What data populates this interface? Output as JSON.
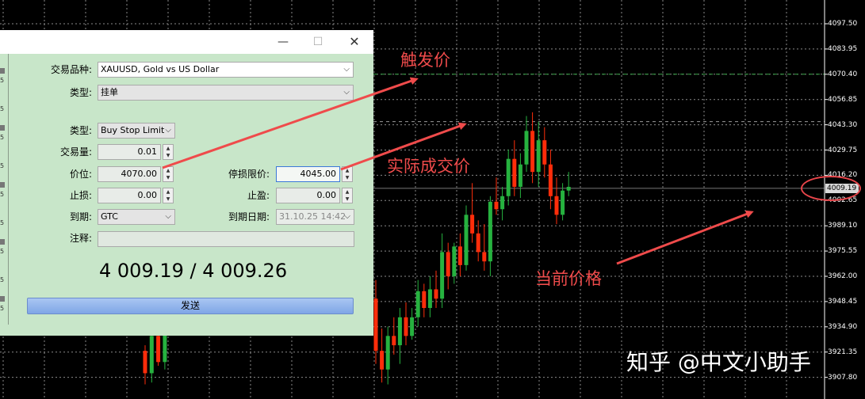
{
  "price_axis": {
    "labels": [
      "4097.50",
      "4083.95",
      "4070.40",
      "4056.85",
      "4043.30",
      "4029.75",
      "4016.20",
      "4002.65",
      "3989.10",
      "3975.55",
      "3962.00",
      "3948.45",
      "3934.90",
      "3921.35",
      "3907.80"
    ],
    "current_price": "4009.19",
    "max": 4100,
    "min": 3904,
    "trigger_line_price": 4070.4,
    "limit_line_price": 4045,
    "current_line_price": 4009.19
  },
  "colors": {
    "bull": "#26b23f",
    "bear": "#ff2d0a",
    "dialog_bg": "#c8e6c9",
    "annotation": "#ef4b4b",
    "trigger_line": "#3aa54a"
  },
  "candles": [
    {
      "o": 3950,
      "h": 3960,
      "l": 3915,
      "c": 3922
    },
    {
      "o": 3922,
      "h": 3934,
      "l": 3905,
      "c": 3912
    },
    {
      "o": 3912,
      "h": 3935,
      "l": 3904,
      "c": 3930
    },
    {
      "o": 3930,
      "h": 3940,
      "l": 3920,
      "c": 3925
    },
    {
      "o": 3925,
      "h": 3945,
      "l": 3915,
      "c": 3940
    },
    {
      "o": 3940,
      "h": 3948,
      "l": 3925,
      "c": 3930
    },
    {
      "o": 3930,
      "h": 3945,
      "l": 3928,
      "c": 3940
    },
    {
      "o": 3940,
      "h": 3960,
      "l": 3935,
      "c": 3954
    },
    {
      "o": 3954,
      "h": 3958,
      "l": 3940,
      "c": 3945
    },
    {
      "o": 3945,
      "h": 3962,
      "l": 3940,
      "c": 3955
    },
    {
      "o": 3955,
      "h": 3965,
      "l": 3945,
      "c": 3950
    },
    {
      "o": 3950,
      "h": 3985,
      "l": 3945,
      "c": 3975
    },
    {
      "o": 3975,
      "h": 3980,
      "l": 3955,
      "c": 3962
    },
    {
      "o": 3962,
      "h": 3980,
      "l": 3958,
      "c": 3978
    },
    {
      "o": 3978,
      "h": 3985,
      "l": 3962,
      "c": 3968
    },
    {
      "o": 3968,
      "h": 4000,
      "l": 3965,
      "c": 3995
    },
    {
      "o": 3995,
      "h": 4012,
      "l": 3980,
      "c": 3985
    },
    {
      "o": 3985,
      "h": 3992,
      "l": 3970,
      "c": 3975
    },
    {
      "o": 3975,
      "h": 3990,
      "l": 3965,
      "c": 3970
    },
    {
      "o": 3970,
      "h": 4005,
      "l": 3962,
      "c": 4002
    },
    {
      "o": 4002,
      "h": 4015,
      "l": 3995,
      "c": 3998
    },
    {
      "o": 3998,
      "h": 4010,
      "l": 3992,
      "c": 4005
    },
    {
      "o": 4005,
      "h": 4030,
      "l": 4000,
      "c": 4025
    },
    {
      "o": 4025,
      "h": 4035,
      "l": 4005,
      "c": 4010
    },
    {
      "o": 4010,
      "h": 4028,
      "l": 4004,
      "c": 4022
    },
    {
      "o": 4022,
      "h": 4048,
      "l": 4018,
      "c": 4040
    },
    {
      "o": 4040,
      "h": 4050,
      "l": 4012,
      "c": 4018
    },
    {
      "o": 4018,
      "h": 4045,
      "l": 4010,
      "c": 4035
    },
    {
      "o": 4035,
      "h": 4042,
      "l": 4015,
      "c": 4022
    },
    {
      "o": 4022,
      "h": 4030,
      "l": 3998,
      "c": 4005
    },
    {
      "o": 4005,
      "h": 4015,
      "l": 3990,
      "c": 3995
    },
    {
      "o": 3995,
      "h": 4012,
      "l": 3992,
      "c": 4008
    },
    {
      "o": 4008,
      "h": 4018,
      "l": 4005,
      "c": 4010
    }
  ],
  "left_candles": [
    {
      "o": 3922,
      "h": 3925,
      "l": 3904,
      "c": 3910
    },
    {
      "o": 3910,
      "h": 3935,
      "l": 3905,
      "c": 3930
    },
    {
      "o": 3930,
      "h": 3932,
      "l": 3914,
      "c": 3916
    },
    {
      "o": 3916,
      "h": 3935,
      "l": 3912,
      "c": 3933
    }
  ],
  "dialog": {
    "symbol_label": "交易品种:",
    "symbol_value": "XAUUSD, Gold vs US Dollar",
    "type_label": "类型:",
    "type_value": "挂单",
    "order_type_label": "类型:",
    "order_type_value": "Buy Stop Limit",
    "volume_label": "交易量:",
    "volume_value": "0.01",
    "price_label": "价位:",
    "price_value": "4070.00",
    "stop_limit_label": "停损限价:",
    "stop_limit_value": "4045.00",
    "sl_label": "止损:",
    "sl_value": "0.00",
    "tp_label": "止盈:",
    "tp_value": "0.00",
    "expiry_label": "到期:",
    "expiry_value": "GTC",
    "expiry_date_label": "到期日期:",
    "expiry_date_value": "31.10.25 14:42",
    "comment_label": "注释:",
    "quote": "4 009.19 / 4 009.26",
    "send_label": "发送",
    "left_strip_digits": [
      "5",
      "5",
      "5",
      "5",
      "5",
      "5",
      "5",
      "5",
      "5"
    ]
  },
  "annotations": {
    "trigger": "触发价",
    "actual": "实际成交价",
    "current": "当前价格"
  },
  "watermark": "知乎 @中文小助手"
}
